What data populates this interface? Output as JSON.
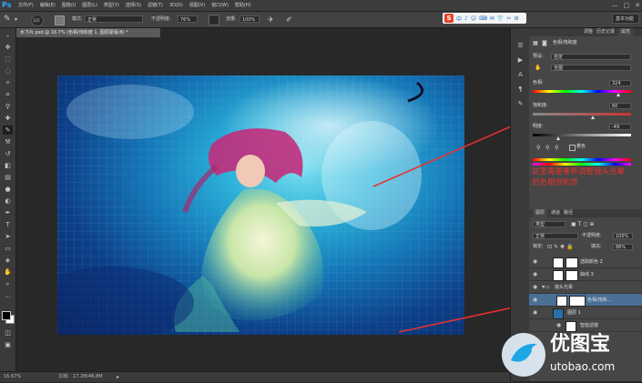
{
  "app": {
    "logo": "Ps"
  },
  "menu": [
    "文件(F)",
    "编辑(E)",
    "图像(I)",
    "图层(L)",
    "类型(Y)",
    "选择(S)",
    "滤镜(T)",
    "3D(D)",
    "视图(V)",
    "窗口(W)",
    "帮助(H)"
  ],
  "window_controls": [
    "—",
    "□",
    "✕"
  ],
  "options_bar": {
    "brush_size": "125",
    "mode_label": "模式:",
    "mode_value": "正常",
    "opacity_label": "不透明度:",
    "opacity_value": "76%",
    "flow_label": "流量:",
    "flow_value": "100%"
  },
  "ime": {
    "logo": "S",
    "items": [
      "中",
      "♪",
      "☺",
      "⌨",
      "✉",
      "👕",
      "✂",
      "⚙"
    ]
  },
  "workspace": "基本功能",
  "document_tab": "水下片.psd @ 16.7% (色相/饱和度 1, 图层蒙版/8) *",
  "status": {
    "zoom": "16.67%",
    "doc_label": "文档:",
    "doc_value": "17.2M/46.8M"
  },
  "properties_panel": {
    "tabs": [
      "调整",
      "历史记录",
      "属性"
    ],
    "adjustment_title": "色相/饱和度",
    "preset_label": "预设:",
    "preset_value": "自定",
    "channel_value": "全图",
    "hue_label": "色相:",
    "hue_value": "324",
    "sat_label": "饱和度:",
    "sat_value": "60",
    "light_label": "明度:",
    "light_value": "-49",
    "colorize_label": "着色"
  },
  "layers_panel": {
    "tabs": [
      "图层",
      "通道",
      "路径"
    ],
    "kind_value": "类型",
    "blend_value": "正常",
    "opacity_label": "不透明度:",
    "opacity_value": "100%",
    "lock_label": "锁定:",
    "fill_label": "填充:",
    "fill_value": "88%",
    "layers": [
      {
        "name": "选取颜色 2",
        "type": "adjustment"
      },
      {
        "name": "曲线 3",
        "type": "adjustment"
      },
      {
        "name": "镜头光晕",
        "type": "group"
      },
      {
        "name": "色相/饱和...",
        "type": "adjustment",
        "selected": true
      },
      {
        "name": "图层 1",
        "type": "pixel"
      },
      {
        "name": "智能滤镜",
        "type": "filter"
      }
    ]
  },
  "annotation": "这里需要重新调整镜头光晕的色相饱和度",
  "watermark": {
    "title": "优图宝",
    "url": "utobao.com"
  },
  "colors": {
    "arrow": "#e8322f",
    "selection": "#4a6f96",
    "accent": "#31a8ff"
  }
}
